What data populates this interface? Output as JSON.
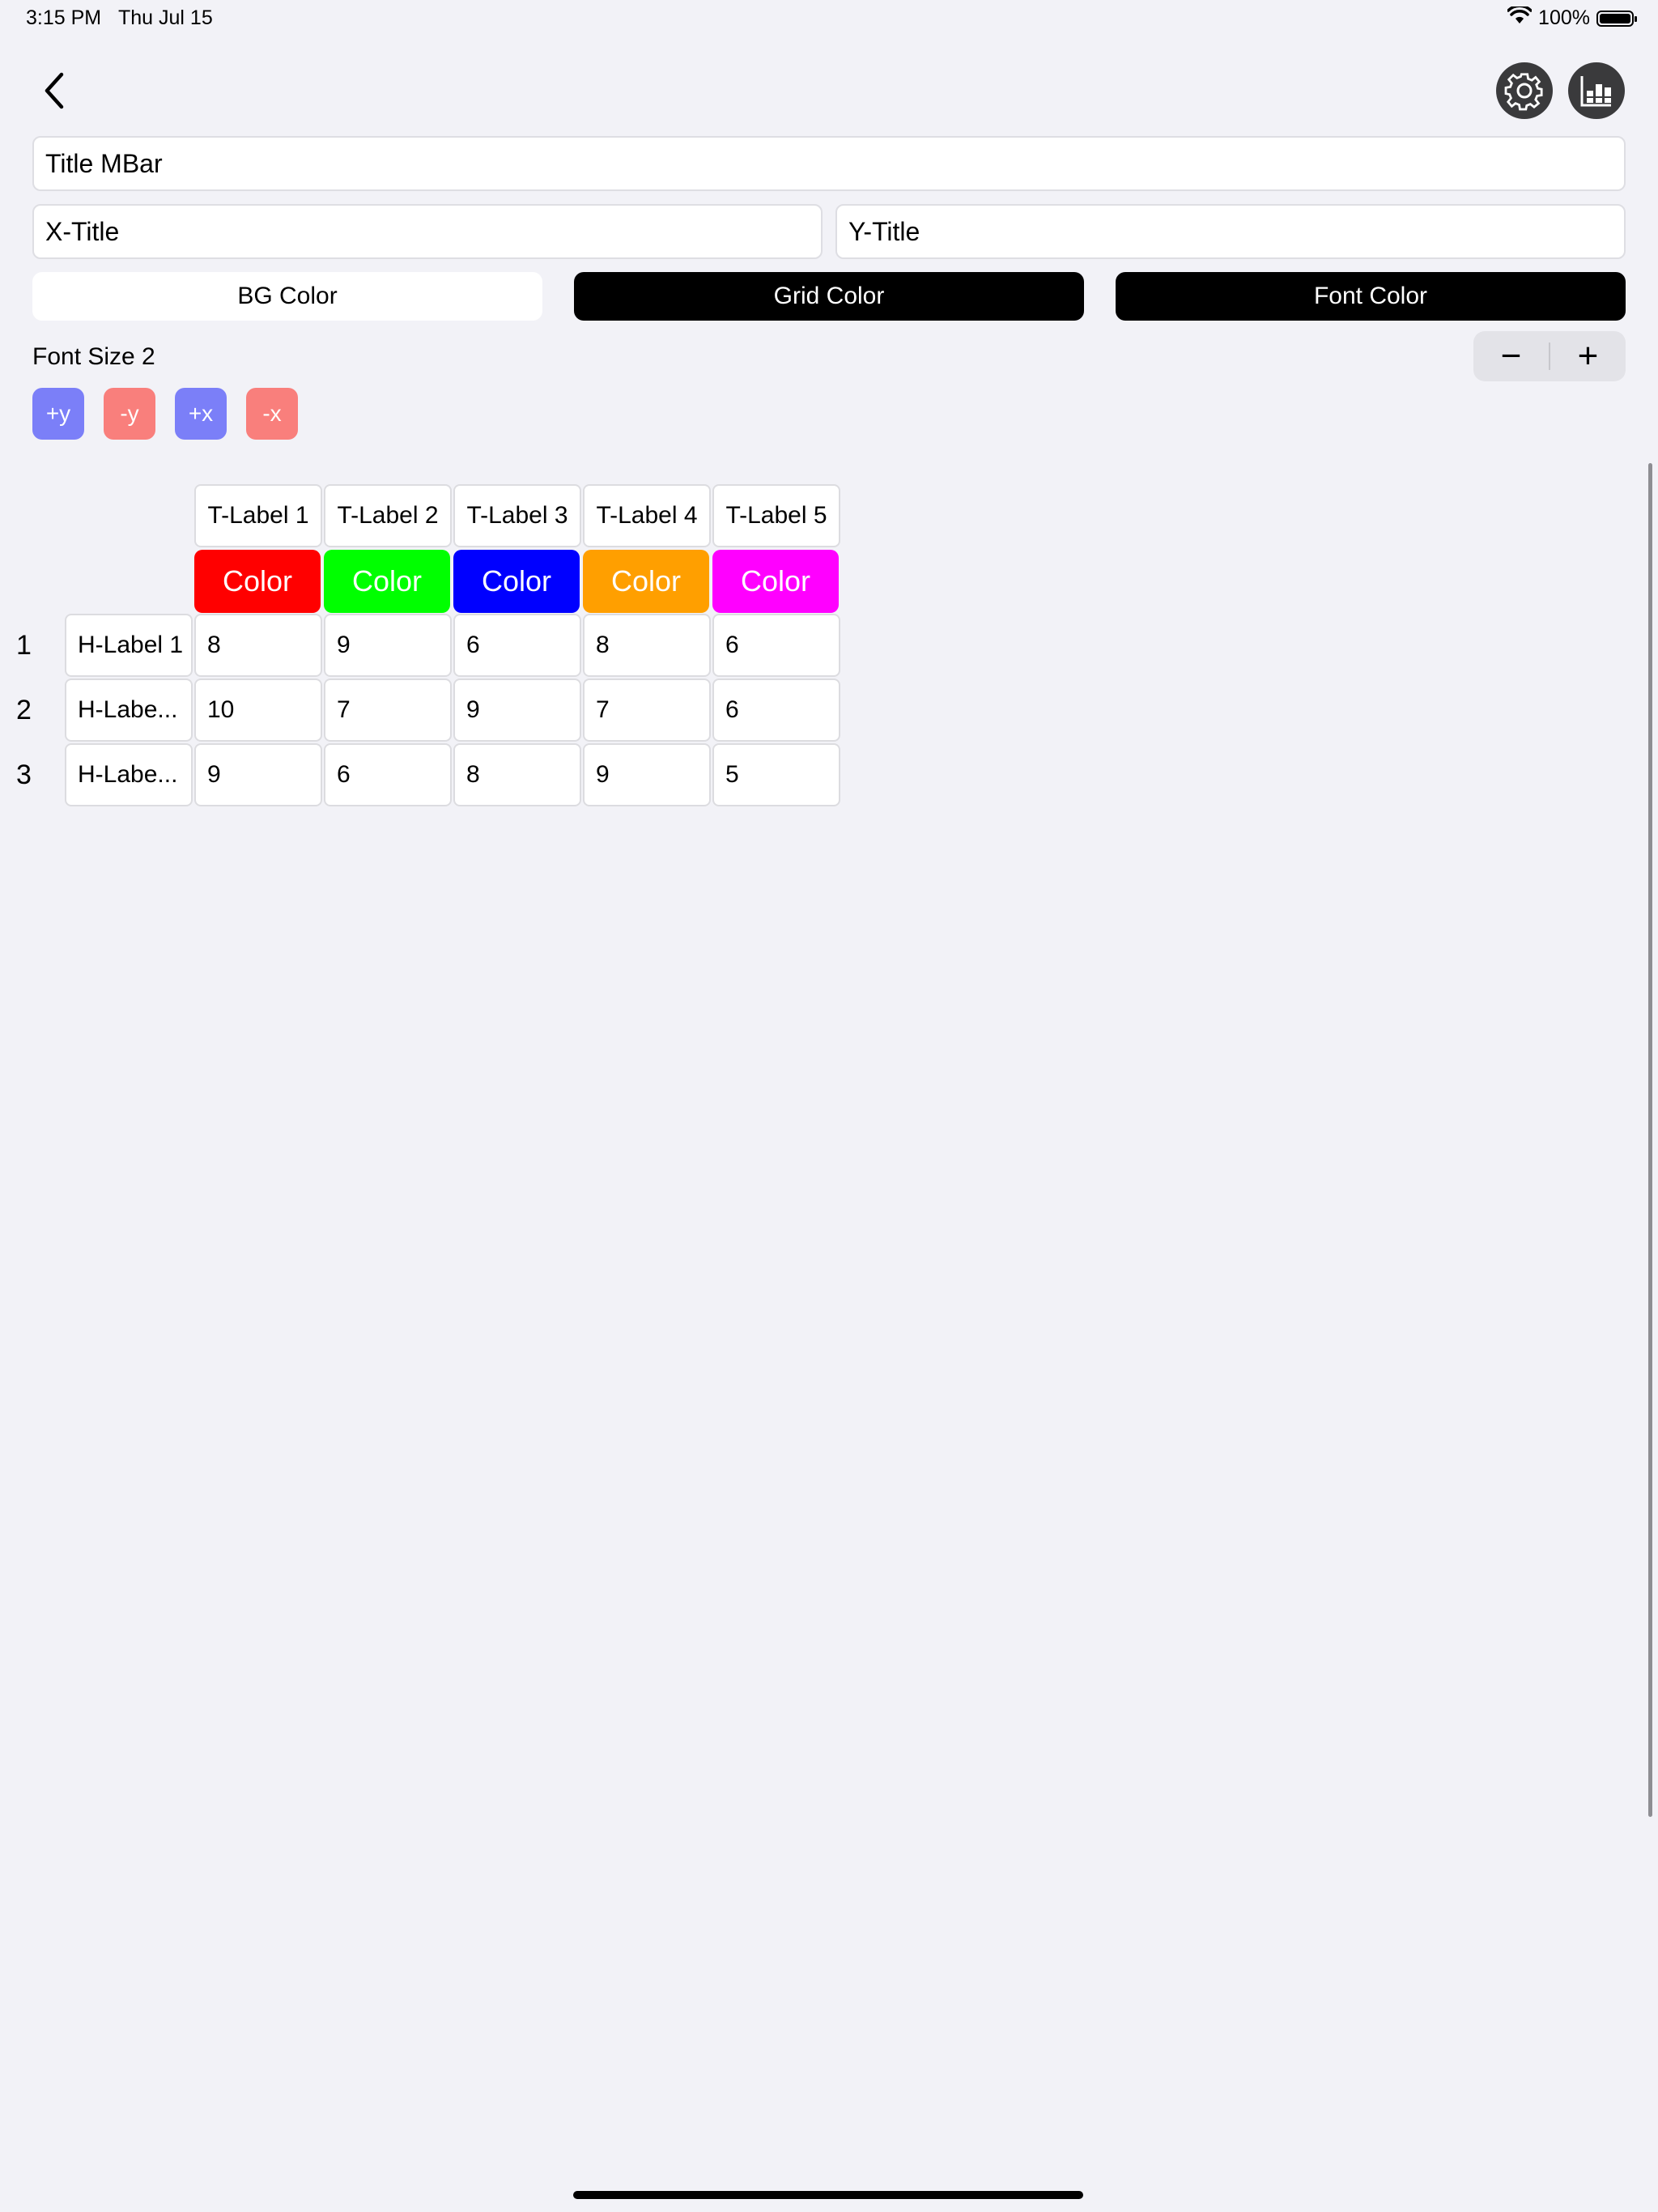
{
  "status_bar": {
    "time": "3:15 PM",
    "date": "Thu Jul 15",
    "battery": "100%"
  },
  "fields": {
    "title": "Title MBar",
    "x_title": "X-Title",
    "y_title": "Y-Title"
  },
  "buttons": {
    "bg_color": "BG Color",
    "grid_color": "Grid Color",
    "font_color": "Font Color"
  },
  "font_size": {
    "label": "Font Size 2",
    "minus": "−",
    "plus": "+"
  },
  "axis_buttons": {
    "plus_y": "+y",
    "minus_y": "-y",
    "plus_x": "+x",
    "minus_x": "-x"
  },
  "table": {
    "columns": [
      "T-Label 1",
      "T-Label 2",
      "T-Label 3",
      "T-Label 4",
      "T-Label 5"
    ],
    "color_label": "Color",
    "column_colors": [
      "#ff0000",
      "#00ff00",
      "#0000ff",
      "#ff9f00",
      "#ff00ff"
    ],
    "rows": [
      {
        "num": "1",
        "label": "H-Label 1",
        "values": [
          "8",
          "9",
          "6",
          "8",
          "6"
        ]
      },
      {
        "num": "2",
        "label": "H-Labe...",
        "values": [
          "10",
          "7",
          "9",
          "7",
          "6"
        ]
      },
      {
        "num": "3",
        "label": "H-Labe...",
        "values": [
          "9",
          "6",
          "8",
          "9",
          "5"
        ]
      }
    ]
  }
}
